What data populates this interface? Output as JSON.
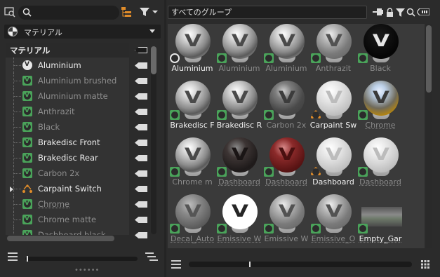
{
  "left_panel": {
    "search": {
      "placeholder": "",
      "value": ""
    },
    "material_dropdown": {
      "label": "マテリアル"
    },
    "tree": {
      "header": "マテリアル",
      "items": [
        {
          "label": "Aluminium",
          "icon": "white-material-icon",
          "style": "bright"
        },
        {
          "label": "Aluminium brushed",
          "icon": "material-icon",
          "style": "dim"
        },
        {
          "label": "Aluminium matte",
          "icon": "material-icon",
          "style": "dim"
        },
        {
          "label": "Anthrazit",
          "icon": "material-icon",
          "style": "dim"
        },
        {
          "label": "Black",
          "icon": "material-icon",
          "style": "dim"
        },
        {
          "label": "Brakedisc Front",
          "icon": "material-icon",
          "style": "bright"
        },
        {
          "label": "Brakedisc Rear",
          "icon": "material-icon",
          "style": "bright"
        },
        {
          "label": "Carbon 2x",
          "icon": "material-icon",
          "style": "dim"
        },
        {
          "label": "Carpaint Switch",
          "icon": "switch-icon",
          "style": "bright"
        },
        {
          "label": "Chrome",
          "icon": "material-icon",
          "style": "dim-underline"
        },
        {
          "label": "Chrome matte",
          "icon": "material-icon",
          "style": "dim"
        },
        {
          "label": "Dashboard black",
          "icon": "material-icon",
          "style": "dim"
        }
      ]
    }
  },
  "right_panel": {
    "group_field": {
      "value": "すべてのグループ"
    },
    "materials": [
      {
        "label": "Aluminium",
        "style": "bright",
        "sphere": "chrome",
        "badge": "white"
      },
      {
        "label": "Aluminium",
        "style": "dim",
        "sphere": "chrome",
        "badge": "green"
      },
      {
        "label": "Aluminium",
        "style": "dim",
        "sphere": "chrome",
        "badge": "green"
      },
      {
        "label": "Anthrazit",
        "style": "dim",
        "sphere": "grey",
        "badge": "green"
      },
      {
        "label": "Black",
        "style": "dim",
        "sphere": "black",
        "badge": "green"
      },
      {
        "label": "Brakedisc F",
        "style": "bright",
        "sphere": "chrome",
        "badge": "green"
      },
      {
        "label": "Brakedisc R",
        "style": "bright",
        "sphere": "chrome",
        "badge": "green"
      },
      {
        "label": "Carbon 2x",
        "style": "dim",
        "sphere": "darkgrey",
        "badge": "green"
      },
      {
        "label": "Carpaint Sw",
        "style": "bright",
        "sphere": "white",
        "badge": "switch"
      },
      {
        "label": "Chrome",
        "style": "dim-under",
        "sphere": "chrome2",
        "badge": "green"
      },
      {
        "label": "Chrome m",
        "style": "dim",
        "sphere": "chrome",
        "badge": "green"
      },
      {
        "label": "Dashboard",
        "style": "dim-under",
        "sphere": "dark",
        "badge": "green"
      },
      {
        "label": "Dashboard",
        "style": "dim-under",
        "sphere": "red",
        "badge": "green"
      },
      {
        "label": "Dashboard",
        "style": "bright",
        "sphere": "white",
        "badge": "switch"
      },
      {
        "label": "Dashboard",
        "style": "dim-under",
        "sphere": "white",
        "badge": "green"
      },
      {
        "label": "Decal_Auto",
        "style": "dim-under",
        "sphere": "grey2",
        "badge": "green"
      },
      {
        "label": "Emissive W",
        "style": "dim-under",
        "sphere": "whiteglow",
        "badge": "green"
      },
      {
        "label": "Emissive W",
        "style": "dim",
        "sphere": "grey",
        "badge": "green"
      },
      {
        "label": "Emissive_O",
        "style": "dim-under",
        "sphere": "grey",
        "badge": "green"
      },
      {
        "label": "Empty_Gar",
        "style": "bright-under",
        "sphere": "image",
        "badge": "green"
      }
    ]
  },
  "colors": {
    "accent_green": "#4aa35a",
    "background": "#2b2b2b",
    "grid_background": "#3a3a3a"
  }
}
